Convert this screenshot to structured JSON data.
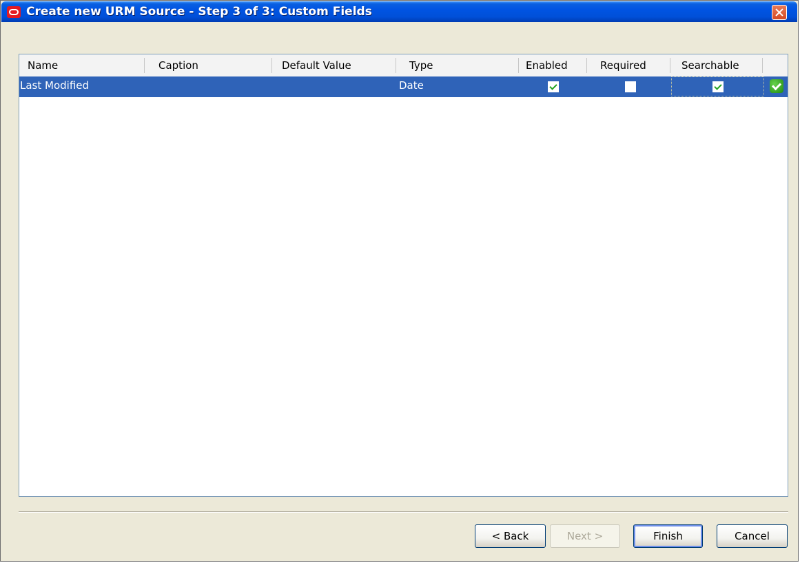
{
  "window": {
    "title": "Create new URM Source - Step 3 of 3: Custom Fields"
  },
  "table": {
    "columns": [
      "Name",
      "Caption",
      "Default Value",
      "Type",
      "Enabled",
      "Required",
      "Searchable"
    ],
    "rows": [
      {
        "name": "Last Modified",
        "caption": "",
        "default_value": "",
        "type": "Date",
        "enabled": true,
        "required": false,
        "searchable": true,
        "status_icon": "green-check-icon"
      }
    ]
  },
  "buttons": {
    "back": "< Back",
    "next": "Next >",
    "finish": "Finish",
    "cancel": "Cancel"
  },
  "colors": {
    "selection": "#2f63b8",
    "titlebar": "#0054e3",
    "check": "#21a121"
  }
}
